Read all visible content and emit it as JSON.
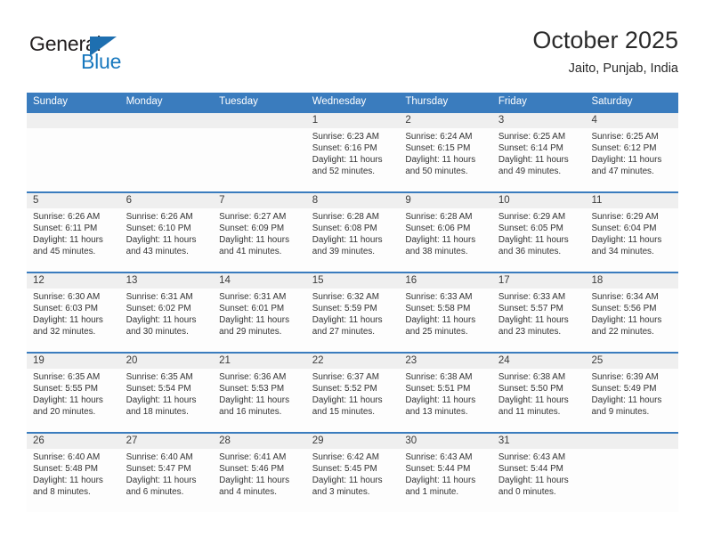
{
  "brand": {
    "name_part1": "General",
    "name_part2": "Blue",
    "logo_icon": "triangle-logo-icon",
    "accent_color": "#1878be"
  },
  "header": {
    "title": "October 2025",
    "location": "Jaito, Punjab, India"
  },
  "calendar": {
    "header_color": "#3a7cbe",
    "date_band_color": "#efefef",
    "weekdays": [
      "Sunday",
      "Monday",
      "Tuesday",
      "Wednesday",
      "Thursday",
      "Friday",
      "Saturday"
    ],
    "weeks": [
      [
        {
          "day": "",
          "sunrise": "",
          "sunset": "",
          "daylight_line1": "",
          "daylight_line2": ""
        },
        {
          "day": "",
          "sunrise": "",
          "sunset": "",
          "daylight_line1": "",
          "daylight_line2": ""
        },
        {
          "day": "",
          "sunrise": "",
          "sunset": "",
          "daylight_line1": "",
          "daylight_line2": ""
        },
        {
          "day": "1",
          "sunrise": "Sunrise: 6:23 AM",
          "sunset": "Sunset: 6:16 PM",
          "daylight_line1": "Daylight: 11 hours",
          "daylight_line2": "and 52 minutes."
        },
        {
          "day": "2",
          "sunrise": "Sunrise: 6:24 AM",
          "sunset": "Sunset: 6:15 PM",
          "daylight_line1": "Daylight: 11 hours",
          "daylight_line2": "and 50 minutes."
        },
        {
          "day": "3",
          "sunrise": "Sunrise: 6:25 AM",
          "sunset": "Sunset: 6:14 PM",
          "daylight_line1": "Daylight: 11 hours",
          "daylight_line2": "and 49 minutes."
        },
        {
          "day": "4",
          "sunrise": "Sunrise: 6:25 AM",
          "sunset": "Sunset: 6:12 PM",
          "daylight_line1": "Daylight: 11 hours",
          "daylight_line2": "and 47 minutes."
        }
      ],
      [
        {
          "day": "5",
          "sunrise": "Sunrise: 6:26 AM",
          "sunset": "Sunset: 6:11 PM",
          "daylight_line1": "Daylight: 11 hours",
          "daylight_line2": "and 45 minutes."
        },
        {
          "day": "6",
          "sunrise": "Sunrise: 6:26 AM",
          "sunset": "Sunset: 6:10 PM",
          "daylight_line1": "Daylight: 11 hours",
          "daylight_line2": "and 43 minutes."
        },
        {
          "day": "7",
          "sunrise": "Sunrise: 6:27 AM",
          "sunset": "Sunset: 6:09 PM",
          "daylight_line1": "Daylight: 11 hours",
          "daylight_line2": "and 41 minutes."
        },
        {
          "day": "8",
          "sunrise": "Sunrise: 6:28 AM",
          "sunset": "Sunset: 6:08 PM",
          "daylight_line1": "Daylight: 11 hours",
          "daylight_line2": "and 39 minutes."
        },
        {
          "day": "9",
          "sunrise": "Sunrise: 6:28 AM",
          "sunset": "Sunset: 6:06 PM",
          "daylight_line1": "Daylight: 11 hours",
          "daylight_line2": "and 38 minutes."
        },
        {
          "day": "10",
          "sunrise": "Sunrise: 6:29 AM",
          "sunset": "Sunset: 6:05 PM",
          "daylight_line1": "Daylight: 11 hours",
          "daylight_line2": "and 36 minutes."
        },
        {
          "day": "11",
          "sunrise": "Sunrise: 6:29 AM",
          "sunset": "Sunset: 6:04 PM",
          "daylight_line1": "Daylight: 11 hours",
          "daylight_line2": "and 34 minutes."
        }
      ],
      [
        {
          "day": "12",
          "sunrise": "Sunrise: 6:30 AM",
          "sunset": "Sunset: 6:03 PM",
          "daylight_line1": "Daylight: 11 hours",
          "daylight_line2": "and 32 minutes."
        },
        {
          "day": "13",
          "sunrise": "Sunrise: 6:31 AM",
          "sunset": "Sunset: 6:02 PM",
          "daylight_line1": "Daylight: 11 hours",
          "daylight_line2": "and 30 minutes."
        },
        {
          "day": "14",
          "sunrise": "Sunrise: 6:31 AM",
          "sunset": "Sunset: 6:01 PM",
          "daylight_line1": "Daylight: 11 hours",
          "daylight_line2": "and 29 minutes."
        },
        {
          "day": "15",
          "sunrise": "Sunrise: 6:32 AM",
          "sunset": "Sunset: 5:59 PM",
          "daylight_line1": "Daylight: 11 hours",
          "daylight_line2": "and 27 minutes."
        },
        {
          "day": "16",
          "sunrise": "Sunrise: 6:33 AM",
          "sunset": "Sunset: 5:58 PM",
          "daylight_line1": "Daylight: 11 hours",
          "daylight_line2": "and 25 minutes."
        },
        {
          "day": "17",
          "sunrise": "Sunrise: 6:33 AM",
          "sunset": "Sunset: 5:57 PM",
          "daylight_line1": "Daylight: 11 hours",
          "daylight_line2": "and 23 minutes."
        },
        {
          "day": "18",
          "sunrise": "Sunrise: 6:34 AM",
          "sunset": "Sunset: 5:56 PM",
          "daylight_line1": "Daylight: 11 hours",
          "daylight_line2": "and 22 minutes."
        }
      ],
      [
        {
          "day": "19",
          "sunrise": "Sunrise: 6:35 AM",
          "sunset": "Sunset: 5:55 PM",
          "daylight_line1": "Daylight: 11 hours",
          "daylight_line2": "and 20 minutes."
        },
        {
          "day": "20",
          "sunrise": "Sunrise: 6:35 AM",
          "sunset": "Sunset: 5:54 PM",
          "daylight_line1": "Daylight: 11 hours",
          "daylight_line2": "and 18 minutes."
        },
        {
          "day": "21",
          "sunrise": "Sunrise: 6:36 AM",
          "sunset": "Sunset: 5:53 PM",
          "daylight_line1": "Daylight: 11 hours",
          "daylight_line2": "and 16 minutes."
        },
        {
          "day": "22",
          "sunrise": "Sunrise: 6:37 AM",
          "sunset": "Sunset: 5:52 PM",
          "daylight_line1": "Daylight: 11 hours",
          "daylight_line2": "and 15 minutes."
        },
        {
          "day": "23",
          "sunrise": "Sunrise: 6:38 AM",
          "sunset": "Sunset: 5:51 PM",
          "daylight_line1": "Daylight: 11 hours",
          "daylight_line2": "and 13 minutes."
        },
        {
          "day": "24",
          "sunrise": "Sunrise: 6:38 AM",
          "sunset": "Sunset: 5:50 PM",
          "daylight_line1": "Daylight: 11 hours",
          "daylight_line2": "and 11 minutes."
        },
        {
          "day": "25",
          "sunrise": "Sunrise: 6:39 AM",
          "sunset": "Sunset: 5:49 PM",
          "daylight_line1": "Daylight: 11 hours",
          "daylight_line2": "and 9 minutes."
        }
      ],
      [
        {
          "day": "26",
          "sunrise": "Sunrise: 6:40 AM",
          "sunset": "Sunset: 5:48 PM",
          "daylight_line1": "Daylight: 11 hours",
          "daylight_line2": "and 8 minutes."
        },
        {
          "day": "27",
          "sunrise": "Sunrise: 6:40 AM",
          "sunset": "Sunset: 5:47 PM",
          "daylight_line1": "Daylight: 11 hours",
          "daylight_line2": "and 6 minutes."
        },
        {
          "day": "28",
          "sunrise": "Sunrise: 6:41 AM",
          "sunset": "Sunset: 5:46 PM",
          "daylight_line1": "Daylight: 11 hours",
          "daylight_line2": "and 4 minutes."
        },
        {
          "day": "29",
          "sunrise": "Sunrise: 6:42 AM",
          "sunset": "Sunset: 5:45 PM",
          "daylight_line1": "Daylight: 11 hours",
          "daylight_line2": "and 3 minutes."
        },
        {
          "day": "30",
          "sunrise": "Sunrise: 6:43 AM",
          "sunset": "Sunset: 5:44 PM",
          "daylight_line1": "Daylight: 11 hours",
          "daylight_line2": "and 1 minute."
        },
        {
          "day": "31",
          "sunrise": "Sunrise: 6:43 AM",
          "sunset": "Sunset: 5:44 PM",
          "daylight_line1": "Daylight: 11 hours",
          "daylight_line2": "and 0 minutes."
        },
        {
          "day": "",
          "sunrise": "",
          "sunset": "",
          "daylight_line1": "",
          "daylight_line2": ""
        }
      ]
    ]
  }
}
